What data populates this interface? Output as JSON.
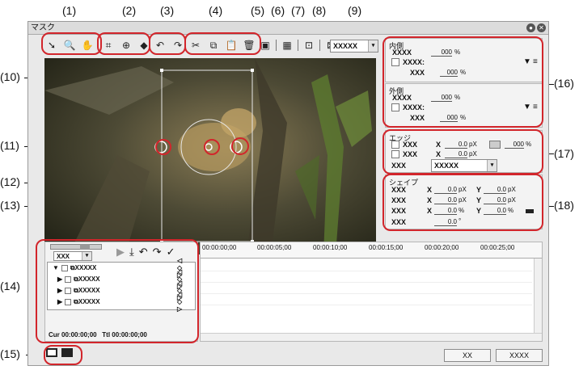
{
  "callouts": [
    "(1)",
    "(2)",
    "(3)",
    "(4)",
    "(5)",
    "(6)",
    "(7)",
    "(8)",
    "(9)",
    "(10)",
    "(11)",
    "(12)",
    "(13)",
    "(14)",
    "(15)",
    "(16)",
    "(17)",
    "(18)"
  ],
  "window": {
    "title": "マスク",
    "gear_glyph": "●",
    "close_glyph": "✕"
  },
  "toolbar": {
    "group1": [
      "➘",
      "🔍",
      "✋"
    ],
    "group2": [
      "⌗",
      "⊕",
      "◆"
    ],
    "group3": [
      "↶",
      "↷"
    ],
    "group4": [
      "✂",
      "⧉",
      "📋",
      "🗑"
    ],
    "single": [
      "▣",
      "▦",
      "⊡",
      "⊠"
    ],
    "zoom_value": "XXXXX",
    "dropdown_arrow": "▾"
  },
  "inner": {
    "title": "内側",
    "row1_label": "XXXX",
    "row1_value": "000",
    "row1_unit": "%",
    "row2_label": "XXXX:",
    "row3_label": "XXX",
    "row3_value": "000",
    "row3_unit": "%",
    "filter_glyph": "▼",
    "list_glyph": "≡"
  },
  "outer": {
    "title": "外側",
    "row1_label": "XXXX",
    "row1_value": "000",
    "row1_unit": "%",
    "row2_label": "XXXX:",
    "row3_label": "XXX",
    "row3_value": "000",
    "row3_unit": "%",
    "filter_glyph": "▼",
    "list_glyph": "≡"
  },
  "edge": {
    "title": "エッジ",
    "r1_label": "XXX",
    "r1_axis": "X",
    "r1_value": "0.0",
    "r1_unit": "pX",
    "r1_pct": "000",
    "r1_pct_unit": "%",
    "r2_label": "XXX",
    "r2_axis": "X",
    "r2_value": "0.0",
    "r2_unit": "pX",
    "r3_label": "XXX",
    "r3_select": "XXXXX",
    "r3_arrow": "▾"
  },
  "shape": {
    "title": "シェイプ",
    "rows": [
      {
        "label": "XXX",
        "xaxis": "X",
        "xval": "0.0",
        "xunit": "pX",
        "yaxis": "Y",
        "yval": "0.0",
        "yunit": "pX"
      },
      {
        "label": "XXX",
        "xaxis": "X",
        "xval": "0.0",
        "xunit": "pX",
        "yaxis": "Y",
        "yval": "0.0",
        "yunit": "pX"
      },
      {
        "label": "XXX",
        "xaxis": "X",
        "xval": "0.0",
        "xunit": "%",
        "yaxis": "Y",
        "yval": "0.0",
        "yunit": "%"
      }
    ],
    "rot_label": "XXX",
    "rot_value": "0.0",
    "rot_unit": "°"
  },
  "timeline": {
    "scale_value": "XXX",
    "ruler": [
      "00:00:00;00",
      "00:00:05;00",
      "00:00:10;00",
      "00:00:15;00",
      "00:00:20;00",
      "00:00:25;00"
    ],
    "transport": [
      "▶",
      "⤓",
      "↶",
      "↷",
      "✓"
    ],
    "tracks": [
      {
        "name": "XXXXX",
        "level": 0,
        "expand": "▼"
      },
      {
        "name": "XXXXX",
        "level": 1,
        "expand": "▶"
      },
      {
        "name": "XXXXX",
        "level": 1,
        "expand": "▶"
      },
      {
        "name": "XXXXX",
        "level": 1,
        "expand": "▶"
      }
    ],
    "key_nav": "◁ ◇ ▷",
    "cur_label": "Cur 00:00:00;00",
    "ttl_label": "Ttl 00:00:00;00"
  },
  "bottom": {
    "ok": "XX",
    "cancel": "XXXX"
  },
  "colors": {
    "callout": "#d2252b",
    "panel_bg": "#f3f3f3"
  }
}
